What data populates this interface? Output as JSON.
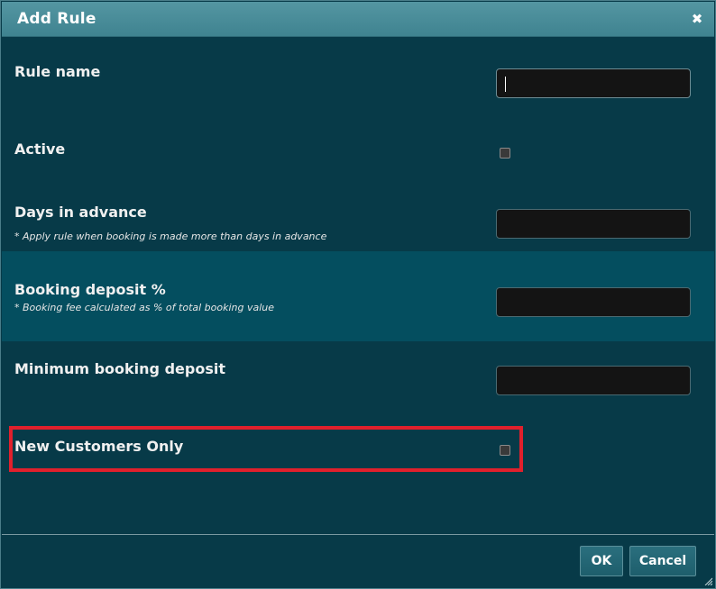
{
  "dialog": {
    "title": "Add Rule",
    "close_icon": "close-icon"
  },
  "fields": {
    "rule_name": {
      "label": "Rule name",
      "value": ""
    },
    "active": {
      "label": "Active",
      "checked": false
    },
    "days_in_advance": {
      "label": "Days in advance",
      "hint": "* Apply rule when booking is made more than days in advance",
      "value": ""
    },
    "booking_deposit_pct": {
      "label": "Booking deposit %",
      "hint": "* Booking fee calculated as % of total booking value",
      "value": ""
    },
    "minimum_booking_deposit": {
      "label": "Minimum booking deposit",
      "value": ""
    },
    "new_customers_only": {
      "label": "New Customers Only",
      "checked": false
    }
  },
  "footer": {
    "ok_label": "OK",
    "cancel_label": "Cancel"
  },
  "colors": {
    "titlebar": "#4a8c98",
    "background": "#073a48",
    "highlight_row": "#044e5f",
    "annotation_box": "#e0202c"
  }
}
